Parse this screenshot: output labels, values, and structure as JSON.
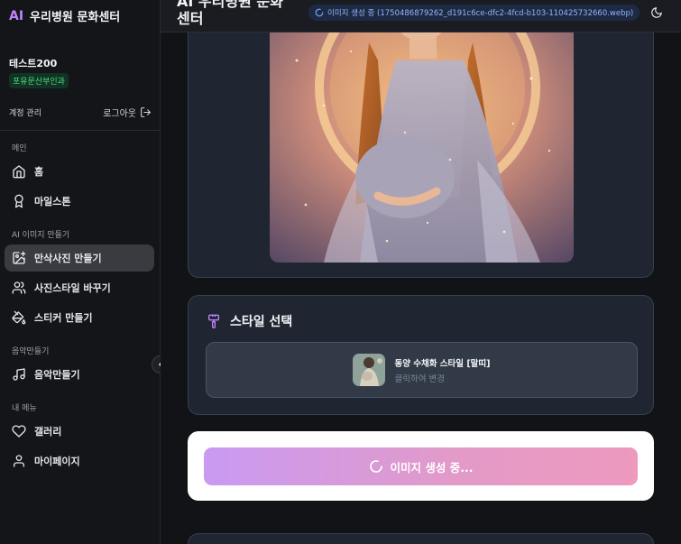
{
  "brand": {
    "logo": "AI",
    "name": "우리병원 문화센터"
  },
  "user": {
    "name": "테스트200",
    "department": "포유문산부인과"
  },
  "account": {
    "manage_label": "계정 관리",
    "logout_label": "로그아웃"
  },
  "sidebar": {
    "sections": [
      {
        "label": "메인"
      },
      {
        "label": "AI 이미지 만들기"
      },
      {
        "label": "음악만들기"
      },
      {
        "label": "내 메뉴"
      }
    ],
    "items": [
      {
        "label": "홈",
        "icon": "home-icon"
      },
      {
        "label": "마일스톤",
        "icon": "award-icon"
      },
      {
        "label": "만삭사진 만들기",
        "icon": "image-plus-icon",
        "active": true
      },
      {
        "label": "사진스타일 바꾸기",
        "icon": "users-icon"
      },
      {
        "label": "스티커 만들기",
        "icon": "paint-bucket-icon"
      },
      {
        "label": "음악만들기",
        "icon": "music-icon"
      },
      {
        "label": "갤러리",
        "icon": "heart-icon"
      },
      {
        "label": "마이페이지",
        "icon": "user-icon"
      }
    ]
  },
  "header": {
    "title": "AI 우리병원 문화센터",
    "status": "이미지 생성 중 (1750486879262_d191c6ce-dfc2-4fcd-b103-110425732660.webp)"
  },
  "style_section": {
    "title": "스타일 선택",
    "selected_name": "동양 수채화 스타일 [말띠]",
    "hint": "클릭하여 변경"
  },
  "generate": {
    "label": "이미지 생성 중..."
  },
  "colors": {
    "accent": "#c084fc",
    "active_bg": "#3a3b41",
    "badge_green": "#4ade80",
    "gradient_start": "#c99af3",
    "gradient_end": "#ee99be"
  }
}
